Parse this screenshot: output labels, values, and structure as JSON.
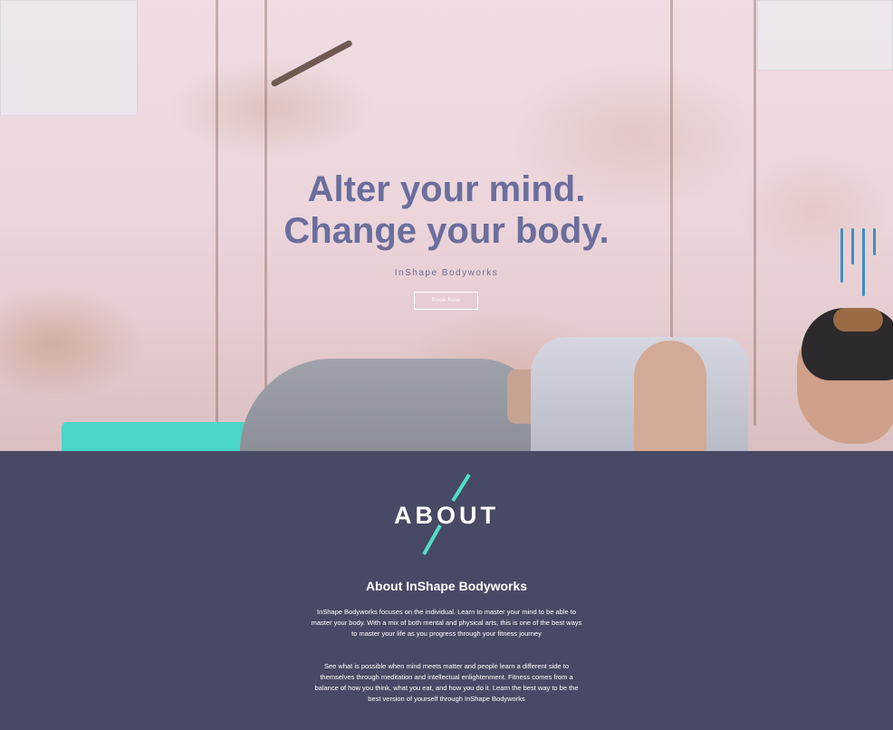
{
  "hero": {
    "title_line1": "Alter your mind.",
    "title_line2": "Change your body.",
    "subtitle": "InShape Bodyworks",
    "cta_label": "Book Now",
    "title_color": "#6b6e9c"
  },
  "about": {
    "heading": "ABOUT",
    "subheading": "About InShape Bodyworks",
    "paragraph1": "InShape Bodyworks focuses on the individual. Learn to master your mind to be able to master your body. With a mix of both mental and physical arts, this is one of the best ways to master your life as you progress through your fitness journey",
    "paragraph2": "See what is possible when mind meets matter and people learn a different side to themselves through meditation and intellectual enlightenment. Fitness comes from a balance of how you think, what you eat, and how you do it. Learn the best way to be the best version of yourself through InShape Bodyworks",
    "background_color": "#484964",
    "accent_color": "#4fe0c4"
  },
  "icons": {
    "emblem": "diagonal-slash-icon"
  }
}
